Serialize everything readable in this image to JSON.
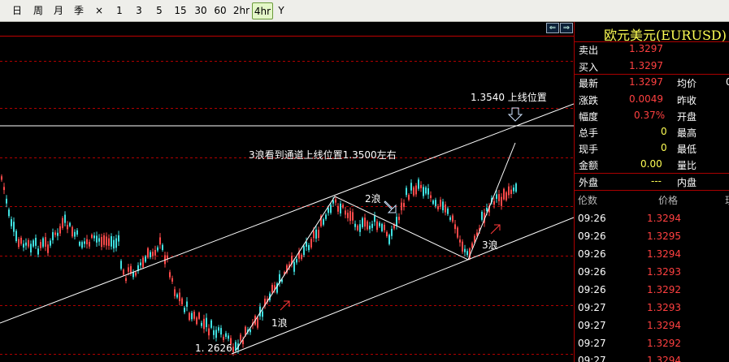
{
  "toolbar": {
    "buttons": [
      {
        "label": "日",
        "active": false
      },
      {
        "label": "周",
        "active": false
      },
      {
        "label": "月",
        "active": false
      },
      {
        "label": "季",
        "active": false
      },
      {
        "label": "×",
        "active": false
      },
      {
        "label": "1",
        "active": false
      },
      {
        "label": "3",
        "active": false
      },
      {
        "label": "5",
        "active": false
      },
      {
        "label": "15",
        "active": false
      },
      {
        "label": "30",
        "active": false
      },
      {
        "label": "60",
        "active": false
      },
      {
        "label": "2hr",
        "active": false
      },
      {
        "label": "4hr",
        "active": true
      },
      {
        "label": "Y",
        "active": false
      }
    ]
  },
  "chart": {
    "annotations": {
      "target_label": "1.3540 上线位置",
      "channel_note": "3浪看到通道上线位置1.3500左右",
      "wave1": "1浪",
      "wave2": "2浪",
      "wave3": "3浪",
      "low_label": "1. 2626"
    },
    "nav_icons": [
      "scroll-left-icon",
      "scroll-right-icon"
    ],
    "colors": {
      "background": "#000000",
      "up_candle": "#ff4a4a",
      "down_candle": "#40e0e0",
      "gridline": "#b00000",
      "trendline": "#ffffff"
    }
  },
  "quote": {
    "title": "欧元美元(EURUSD)",
    "sell_label": "卖出",
    "sell": "1.3297",
    "buy_label": "买入",
    "buy": "1.3297",
    "last_label": "最新",
    "last": "1.3297",
    "avg_label": "均价",
    "avg_cut": "0",
    "change_label": "涨跌",
    "change": "0.0049",
    "prevclose_label": "昨收",
    "amp_label": "幅度",
    "amp": "0.37%",
    "open_label": "开盘",
    "volume_label": "总手",
    "volume": "0",
    "high_label": "最高",
    "cur_label": "现手",
    "cur": "0",
    "low_label": "最低",
    "amount_label": "金额",
    "amount": "0.00",
    "ratio_label": "量比",
    "outer_label": "外盘",
    "outer": "---",
    "inner_label": "内盘"
  },
  "ticks": {
    "headers": [
      "伦数",
      "价格",
      "现"
    ],
    "rows": [
      {
        "time": "09:26",
        "price": "1.3294"
      },
      {
        "time": "09:26",
        "price": "1.3295"
      },
      {
        "time": "09:26",
        "price": "1.3294"
      },
      {
        "time": "09:26",
        "price": "1.3293"
      },
      {
        "time": "09:26",
        "price": "1.3292"
      },
      {
        "time": "09:27",
        "price": "1.3293"
      },
      {
        "time": "09:27",
        "price": "1.3294"
      },
      {
        "time": "09:27",
        "price": "1.3292"
      },
      {
        "time": "09:27",
        "price": "1.3294"
      }
    ]
  }
}
